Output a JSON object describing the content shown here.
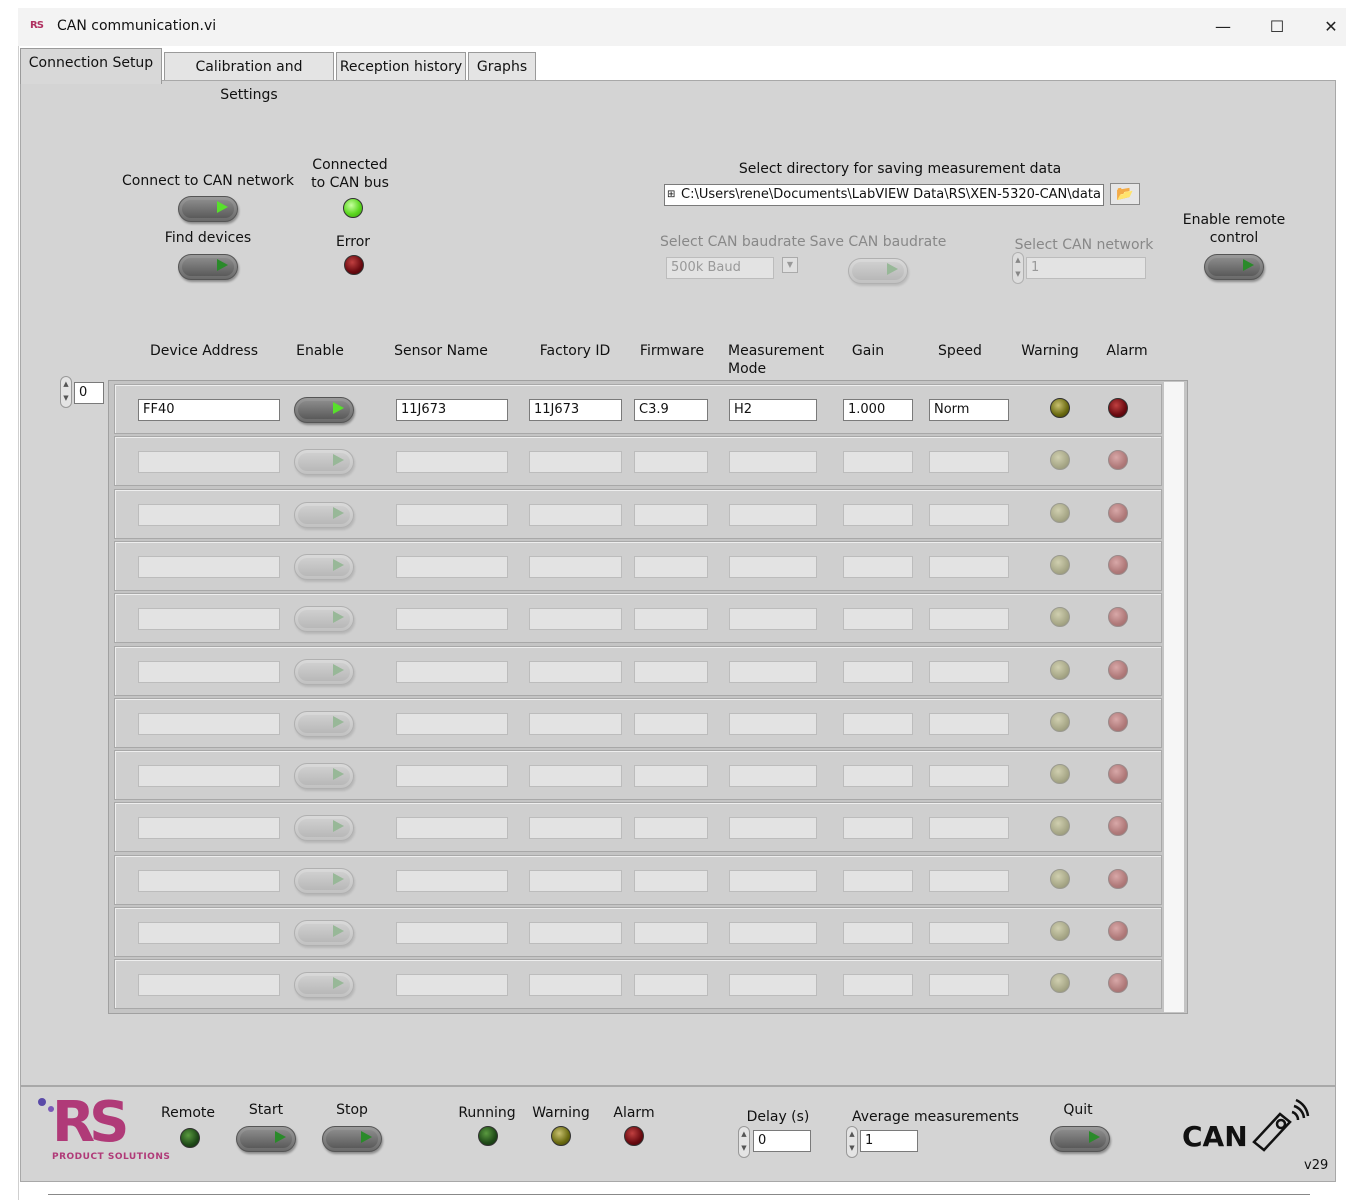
{
  "window": {
    "title": "CAN communication.vi",
    "logo_text": "RS",
    "controls": {
      "minimize": "—",
      "maximize": "☐",
      "close": "✕"
    }
  },
  "tabs": [
    {
      "label": "Connection Setup",
      "active": true
    },
    {
      "label": "Calibration and Settings",
      "active": false
    },
    {
      "label": "Reception history",
      "active": false
    },
    {
      "label": "Graphs",
      "active": false
    }
  ],
  "connection": {
    "connect_label": "Connect to CAN network",
    "find_label": "Find devices",
    "connected_label_1": "Connected",
    "connected_label_2": "to CAN bus",
    "error_label": "Error",
    "connect_on": true
  },
  "directory": {
    "label": "Select directory for saving measurement data",
    "path": "C:\\Users\\rene\\Documents\\LabVIEW Data\\RS\\XEN-5320-CAN\\data"
  },
  "baud": {
    "label": "Select CAN baudrate",
    "value": "500k Baud",
    "save_label": "Save CAN baudrate"
  },
  "network": {
    "label": "Select CAN network",
    "value": "1"
  },
  "remote_control": {
    "label_1": "Enable remote",
    "label_2": "control"
  },
  "table": {
    "index": "0",
    "columns": [
      "Device Address",
      "Enable",
      "Sensor Name",
      "Factory ID",
      "Firmware",
      "Measurement",
      "Gain",
      "Speed",
      "Warning",
      "Alarm"
    ],
    "column_measurement_line2": "Mode",
    "rows": [
      {
        "address": "FF40",
        "sensor": "11J673",
        "factory": "11J673",
        "firmware": "C3.9",
        "mode": "H2",
        "gain": "1.000",
        "speed": "Norm",
        "active": true
      },
      {
        "address": "",
        "sensor": "",
        "factory": "",
        "firmware": "",
        "mode": "",
        "gain": "",
        "speed": "",
        "active": false
      },
      {
        "address": "",
        "sensor": "",
        "factory": "",
        "firmware": "",
        "mode": "",
        "gain": "",
        "speed": "",
        "active": false
      },
      {
        "address": "",
        "sensor": "",
        "factory": "",
        "firmware": "",
        "mode": "",
        "gain": "",
        "speed": "",
        "active": false
      },
      {
        "address": "",
        "sensor": "",
        "factory": "",
        "firmware": "",
        "mode": "",
        "gain": "",
        "speed": "",
        "active": false
      },
      {
        "address": "",
        "sensor": "",
        "factory": "",
        "firmware": "",
        "mode": "",
        "gain": "",
        "speed": "",
        "active": false
      },
      {
        "address": "",
        "sensor": "",
        "factory": "",
        "firmware": "",
        "mode": "",
        "gain": "",
        "speed": "",
        "active": false
      },
      {
        "address": "",
        "sensor": "",
        "factory": "",
        "firmware": "",
        "mode": "",
        "gain": "",
        "speed": "",
        "active": false
      },
      {
        "address": "",
        "sensor": "",
        "factory": "",
        "firmware": "",
        "mode": "",
        "gain": "",
        "speed": "",
        "active": false
      },
      {
        "address": "",
        "sensor": "",
        "factory": "",
        "firmware": "",
        "mode": "",
        "gain": "",
        "speed": "",
        "active": false
      },
      {
        "address": "",
        "sensor": "",
        "factory": "",
        "firmware": "",
        "mode": "",
        "gain": "",
        "speed": "",
        "active": false
      },
      {
        "address": "",
        "sensor": "",
        "factory": "",
        "firmware": "",
        "mode": "",
        "gain": "",
        "speed": "",
        "active": false
      }
    ]
  },
  "bottom": {
    "logo_main": "RS",
    "logo_sub": "PRODUCT SOLUTIONS",
    "remote_label": "Remote",
    "start_label": "Start",
    "stop_label": "Stop",
    "running_label": "Running",
    "warning_label": "Warning",
    "alarm_label": "Alarm",
    "delay_label": "Delay (s)",
    "delay_value": "0",
    "average_label": "Average measurements",
    "average_value": "1",
    "quit_label": "Quit",
    "can_logo": "CAN",
    "version": "v29"
  },
  "colors": {
    "panel": "#d4d4d4",
    "led_green": "#5cd820",
    "led_red": "#6a0a10",
    "led_olive": "#6a6a10",
    "brand": "#b03a78"
  }
}
